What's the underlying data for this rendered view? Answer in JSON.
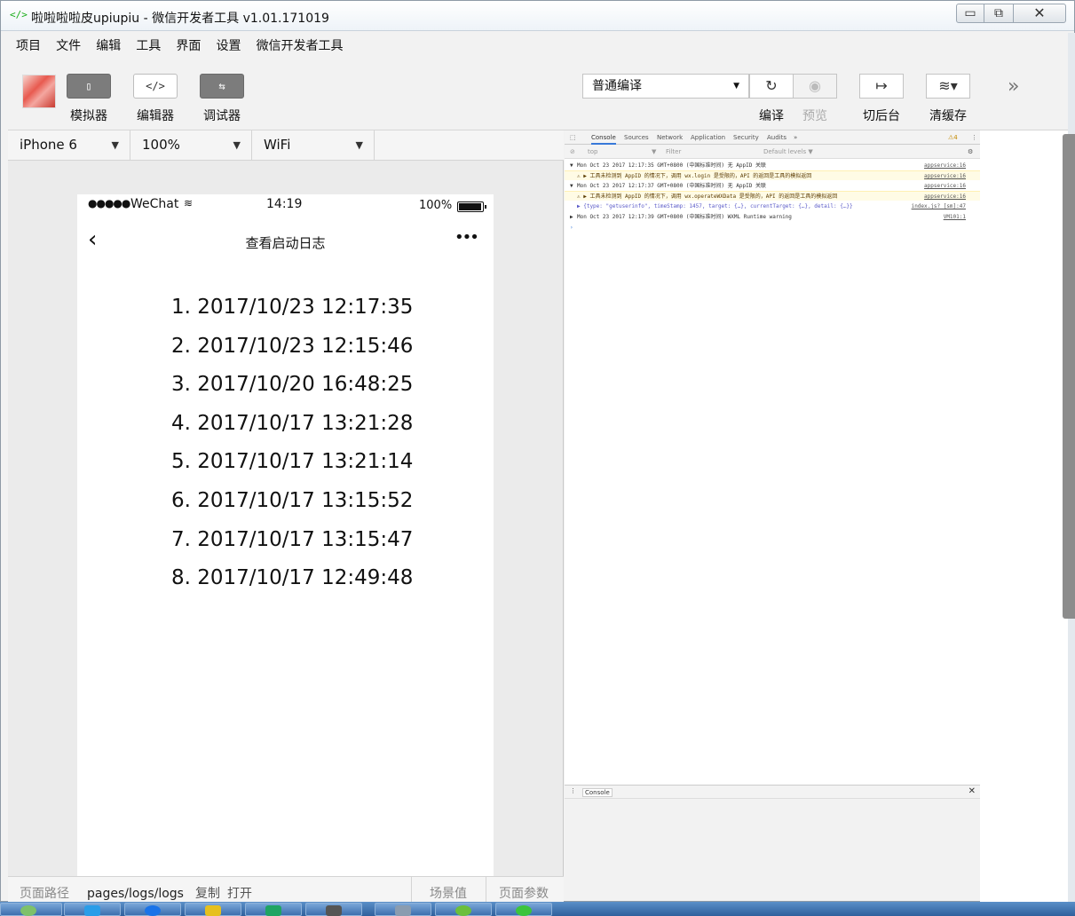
{
  "window": {
    "title": "啦啦啦啦皮upiupiu - 微信开发者工具 v1.01.171019",
    "app_icon": "</>",
    "controls": {
      "minimize": "▭",
      "maximize": "⧉",
      "close": "✕"
    }
  },
  "menu": [
    "项目",
    "文件",
    "编辑",
    "工具",
    "界面",
    "设置",
    "微信开发者工具"
  ],
  "toolbar": {
    "simulator": {
      "icon": "▯",
      "label": "模拟器"
    },
    "editor": {
      "icon": "</>",
      "label": "编辑器"
    },
    "debugger": {
      "icon": "⇆",
      "label": "调试器"
    },
    "compile_mode": "普通编译",
    "compile": {
      "icon": "↻",
      "label": "编译"
    },
    "preview": {
      "icon": "◉",
      "label": "预览"
    },
    "background": {
      "icon": "↦",
      "label": "切后台"
    },
    "clear_cache": {
      "icon": "≋▾",
      "label": "清缓存"
    },
    "more": "»"
  },
  "device_bar": {
    "device": "iPhone 6",
    "zoom": "100%",
    "network": "WiFi"
  },
  "phone": {
    "status": {
      "signal": "●●●●●",
      "carrier": "WeChat",
      "wifi": "≋",
      "time": "14:19",
      "battery": "100%"
    },
    "nav": {
      "back": "‹",
      "title": "查看启动日志",
      "menu": "•••"
    },
    "logs": [
      "1. 2017/10/23 12:17:35",
      "2. 2017/10/23 12:15:46",
      "3. 2017/10/20 16:48:25",
      "4. 2017/10/17 13:21:28",
      "5. 2017/10/17 13:21:14",
      "6. 2017/10/17 13:15:52",
      "7. 2017/10/17 13:15:47",
      "8. 2017/10/17 12:49:48"
    ]
  },
  "pathbar": {
    "label": "页面路径",
    "path": "pages/logs/logs",
    "copy": "复制",
    "open": "打开",
    "scene": "场景值",
    "params": "页面参数"
  },
  "devtools": {
    "tabs": [
      "Console",
      "Sources",
      "Network",
      "Application",
      "Security",
      "Audits",
      "»"
    ],
    "warn_count": "⚠4",
    "context": "top",
    "filter_placeholder": "Filter",
    "levels": "Default levels ▼",
    "lines": [
      {
        "kind": "group",
        "text": "Mon Oct 23 2017 12:17:35 GMT+0800 (中国标准时间) 无 AppID 关联",
        "src": "appservice:16"
      },
      {
        "kind": "warn",
        "text": "⚠ ▶ 工具未检测到 AppID 的情况下，调用 wx.login 是受限的，API 的返回是工具的模拟返回",
        "src": "appservice:16"
      },
      {
        "kind": "group",
        "text": "Mon Oct 23 2017 12:17:37 GMT+0800 (中国标准时间) 无 AppID 关联",
        "src": "appservice:16"
      },
      {
        "kind": "warn",
        "text": "⚠ ▶ 工具未检测到 AppID 的情况下，调用 wx.operateWXData 是受限的，API 的返回是工具的模拟返回",
        "src": "appservice:16"
      },
      {
        "kind": "obj",
        "text": "▶ {type: \"getuserinfo\", timeStamp: 1457, target: {…}, currentTarget: {…}, detail: {…}}",
        "src": "index.js? [sm]:47"
      },
      {
        "kind": "group",
        "text": "Mon Oct 23 2017 12:17:39 GMT+0800 (中国标准时间) WXML Runtime warning",
        "src": "VM101:1"
      }
    ],
    "drawer_tab": "Console",
    "drawer_close": "✕"
  }
}
